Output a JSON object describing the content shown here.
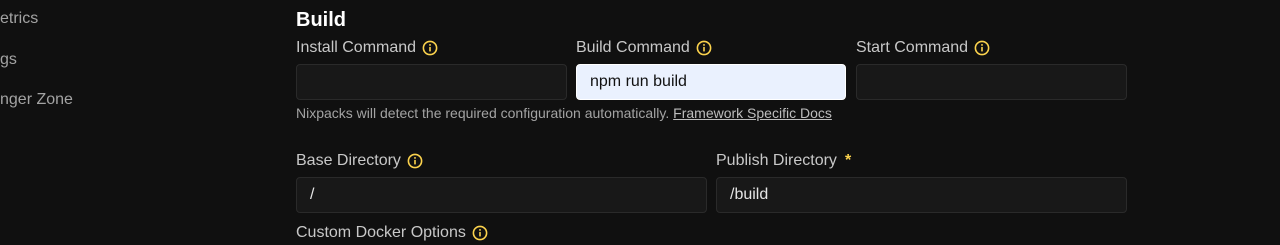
{
  "sidebar": {
    "items": [
      {
        "label": "etrics"
      },
      {
        "label": "gs"
      },
      {
        "label": "nger Zone"
      }
    ]
  },
  "build": {
    "title": "Build",
    "install_label": "Install Command",
    "install_value": "",
    "build_label": "Build Command",
    "build_value": "npm run build",
    "start_label": "Start Command",
    "start_value": "",
    "helper_text": "Nixpacks will detect the required configuration automatically. ",
    "helper_link": "Framework Specific Docs",
    "base_dir_label": "Base Directory",
    "base_dir_value": "/",
    "publish_dir_label": "Publish Directory",
    "publish_required": "*",
    "publish_dir_value": "/build",
    "docker_options_label": "Custom Docker Options"
  },
  "colors": {
    "background": "#101010",
    "accent_info": "#fcd34d",
    "active_field_bg": "#eaf1fe"
  }
}
